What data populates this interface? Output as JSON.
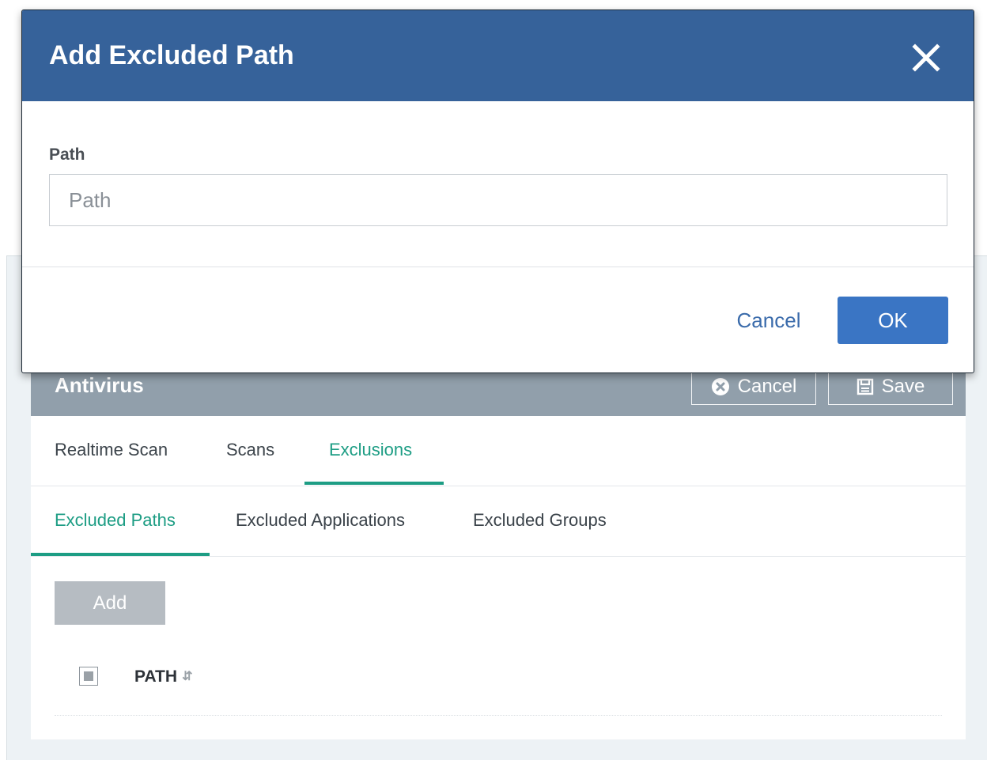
{
  "modal": {
    "title": "Add Excluded Path",
    "close_icon": "close-icon",
    "field_label": "Path",
    "field_placeholder": "Path",
    "field_value": "",
    "cancel_label": "Cancel",
    "ok_label": "OK"
  },
  "panel": {
    "title": "Antivirus",
    "cancel_label": "Cancel",
    "save_label": "Save",
    "cancel_icon": "circle-x-icon",
    "save_icon": "floppy-icon",
    "tabs": [
      {
        "label": "Realtime Scan",
        "active": false
      },
      {
        "label": "Scans",
        "active": false
      },
      {
        "label": "Exclusions",
        "active": true
      }
    ],
    "subtabs": [
      {
        "label": "Excluded Paths",
        "active": true
      },
      {
        "label": "Excluded Applications",
        "active": false
      },
      {
        "label": "Excluded Groups",
        "active": false
      }
    ],
    "add_label": "Add",
    "table": {
      "columns": [
        {
          "label": "PATH",
          "sortable": true
        }
      ],
      "rows": []
    }
  },
  "colors": {
    "modal_header": "#36629a",
    "ok_button": "#3a75c4",
    "panel_header": "#919fab",
    "active_tab": "#1d9d84",
    "page_background": "#edf2f5"
  }
}
